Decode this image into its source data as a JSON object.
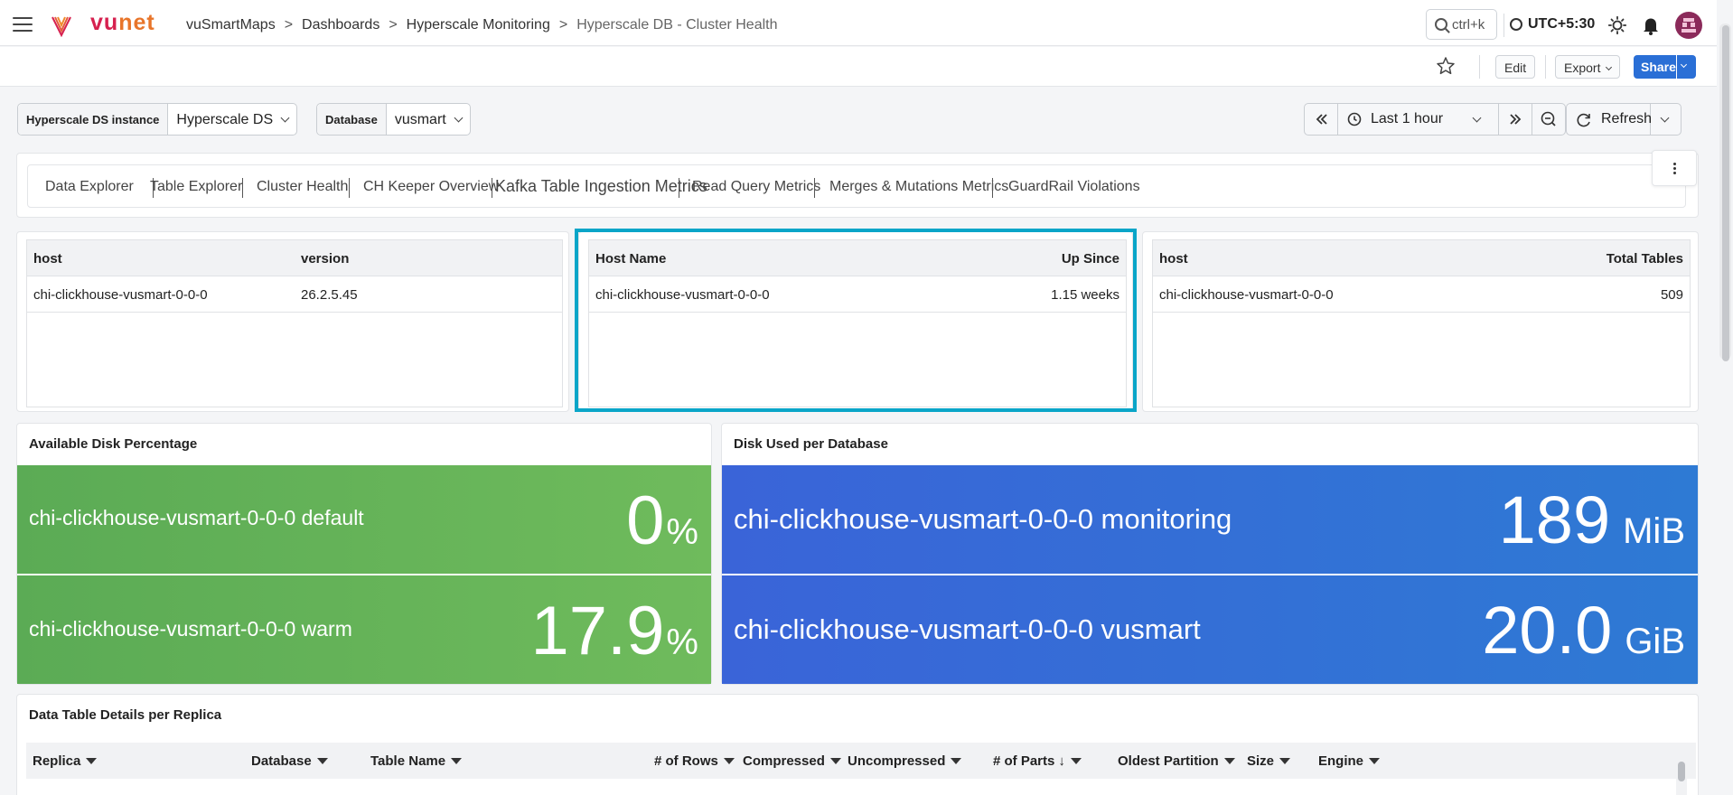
{
  "header": {
    "brand_vu": "vu",
    "brand_net": "net",
    "breadcrumbs": [
      "vuSmartMaps",
      "Dashboards",
      "Hyperscale Monitoring",
      "Hyperscale DB - Cluster Health"
    ],
    "search_shortcut": "ctrl+k",
    "timezone": "UTC+5:30"
  },
  "actions": {
    "edit": "Edit",
    "export": "Export",
    "share": "Share"
  },
  "filters": [
    {
      "label": "Hyperscale DS instance",
      "value": "Hyperscale DS"
    },
    {
      "label": "Database",
      "value": "vusmart"
    }
  ],
  "time": {
    "range": "Last 1 hour",
    "refresh": "Refresh"
  },
  "tabs": [
    "Data Explorer",
    "Table Explorer",
    "Cluster Health",
    "CH Keeper Overview",
    "Kafka Table Ingestion Metrics",
    "Read Query Metrics",
    "Merges & Mutations Metrics",
    "GuardRail Violations"
  ],
  "tables": {
    "version": {
      "cols": [
        "host",
        "version"
      ],
      "row": [
        "chi-clickhouse-vusmart-0-0-0",
        "26.2.5.45"
      ]
    },
    "uptime": {
      "cols": [
        "Host Name",
        "Up Since"
      ],
      "row": [
        "chi-clickhouse-vusmart-0-0-0",
        "1.15 weeks"
      ]
    },
    "tables": {
      "cols": [
        "host",
        "Total Tables"
      ],
      "row": [
        "chi-clickhouse-vusmart-0-0-0",
        "509"
      ]
    }
  },
  "disk_available": {
    "title": "Available Disk Percentage",
    "items": [
      {
        "name": "chi-clickhouse-vusmart-0-0-0 default",
        "value": "0",
        "unit": "%"
      },
      {
        "name": "chi-clickhouse-vusmart-0-0-0 warm",
        "value": "17.9",
        "unit": "%"
      }
    ]
  },
  "disk_used": {
    "title": "Disk Used per Database",
    "items": [
      {
        "name": "chi-clickhouse-vusmart-0-0-0 monitoring",
        "value": "189",
        "unit": "MiB"
      },
      {
        "name": "chi-clickhouse-vusmart-0-0-0 vusmart",
        "value": "20.0",
        "unit": "GiB"
      }
    ]
  },
  "details": {
    "title": "Data Table Details per Replica",
    "columns": [
      "Replica",
      "Database",
      "Table Name",
      "# of Rows",
      "Compressed",
      "Uncompressed",
      "# of Parts",
      "Oldest Partition",
      "Size",
      "Engine"
    ]
  },
  "colors": {
    "accent": "#2a6fd6",
    "highlight": "#0aa5c8",
    "green": "#6ab95a",
    "blue": "#3a64d8"
  }
}
